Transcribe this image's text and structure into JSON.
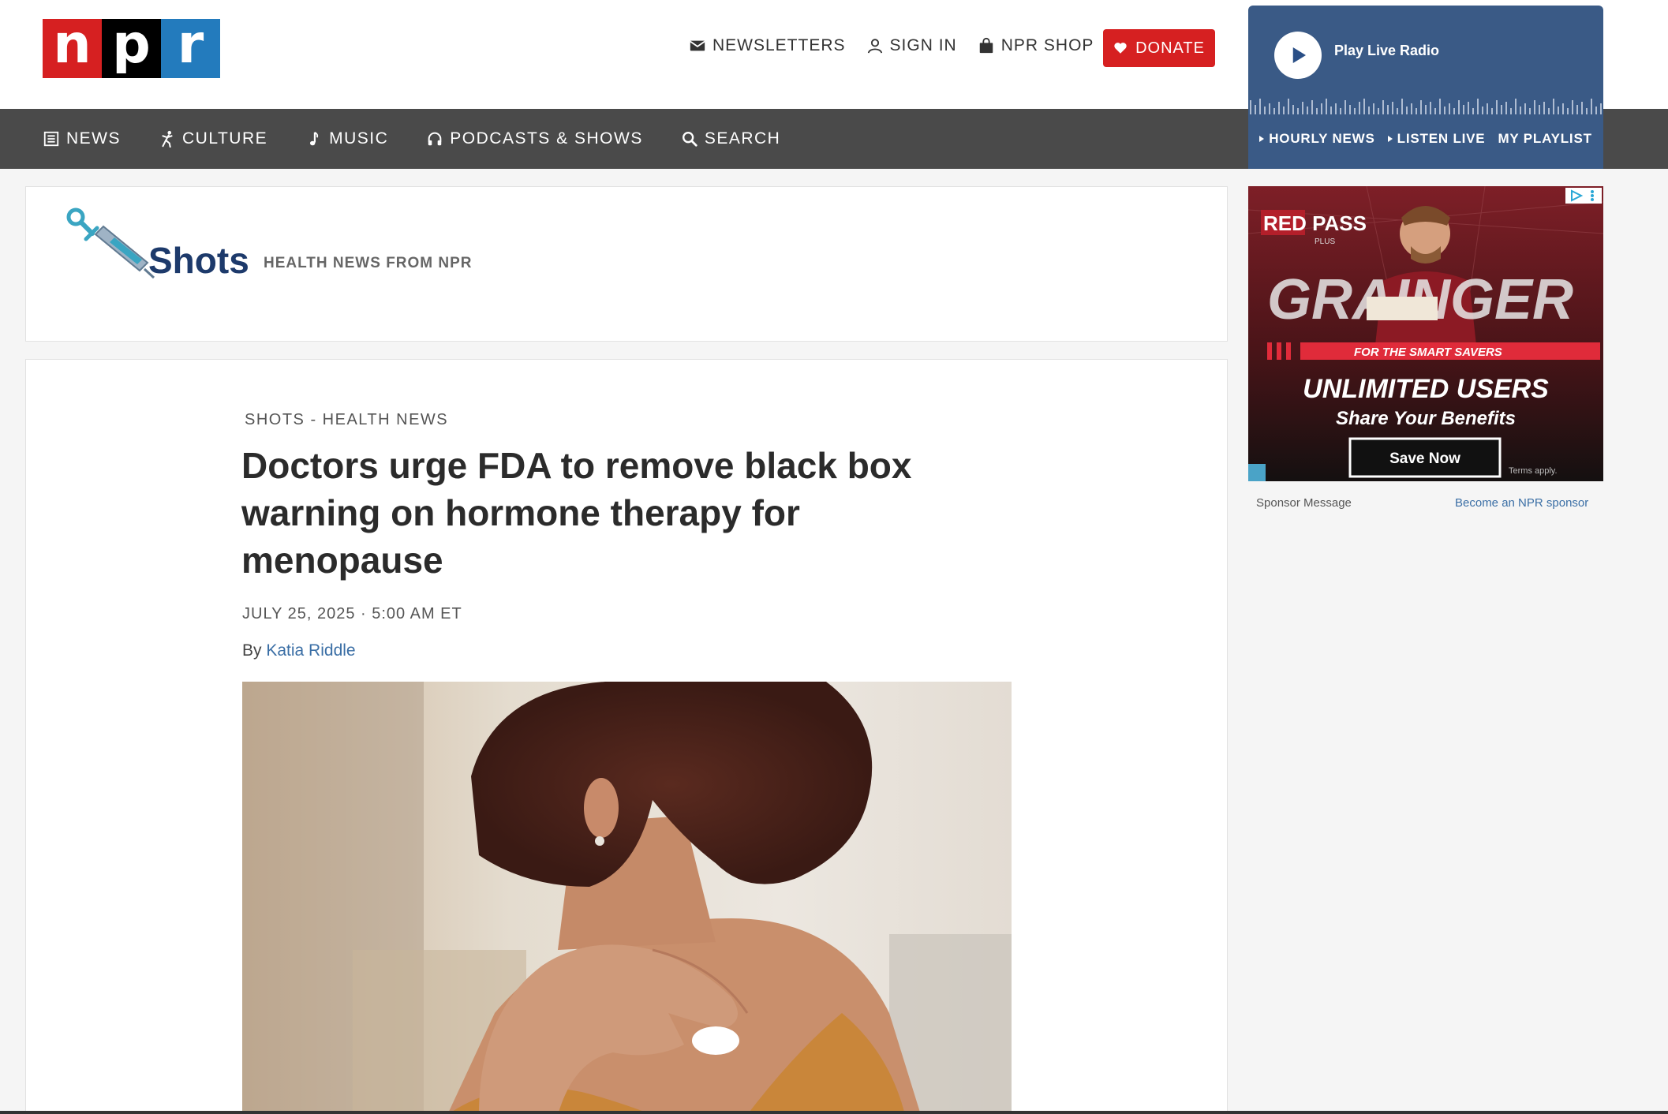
{
  "brand": {
    "logo_letters": [
      "n",
      "p",
      "r"
    ],
    "colors": {
      "red": "#d62021",
      "black": "#000000",
      "blue": "#237bbd"
    }
  },
  "utility_nav": [
    {
      "label": "NEWSLETTERS",
      "icon": "envelope-icon"
    },
    {
      "label": "SIGN IN",
      "icon": "user-icon"
    },
    {
      "label": "NPR SHOP",
      "icon": "shopping-bag-icon"
    }
  ],
  "donate": {
    "label": "DONATE",
    "icon": "heart-icon"
  },
  "main_nav": [
    {
      "label": "NEWS",
      "icon": "news-icon"
    },
    {
      "label": "CULTURE",
      "icon": "culture-icon"
    },
    {
      "label": "MUSIC",
      "icon": "music-note-icon"
    },
    {
      "label": "PODCASTS & SHOWS",
      "icon": "headphones-icon"
    },
    {
      "label": "SEARCH",
      "icon": "search-icon"
    }
  ],
  "live_radio": {
    "play_label": "Play Live Radio",
    "links": [
      "HOURLY NEWS",
      "LISTEN LIVE",
      "MY PLAYLIST"
    ]
  },
  "shots": {
    "title": "Shots",
    "subtitle": "HEALTH NEWS FROM NPR"
  },
  "article": {
    "kicker": "SHOTS - HEALTH NEWS",
    "headline": "Doctors urge FDA to remove black box warning on hormone therapy for menopause",
    "dateline": "JULY 25, 2025 · 5:00 AM ET",
    "byline_prefix": "By",
    "author": "Katia Riddle"
  },
  "ad": {
    "brand_top": "RED PASS",
    "brand_plus": "PLUS",
    "sponsor_name": "GRAINGER",
    "tagline": "FOR THE SMART SAVERS",
    "headline": "UNLIMITED USERS",
    "subhead": "Share Your Benefits",
    "cta": "Save Now",
    "terms": "Terms apply.",
    "sponsor_message": "Sponsor Message",
    "become_sponsor": "Become an NPR sponsor"
  }
}
